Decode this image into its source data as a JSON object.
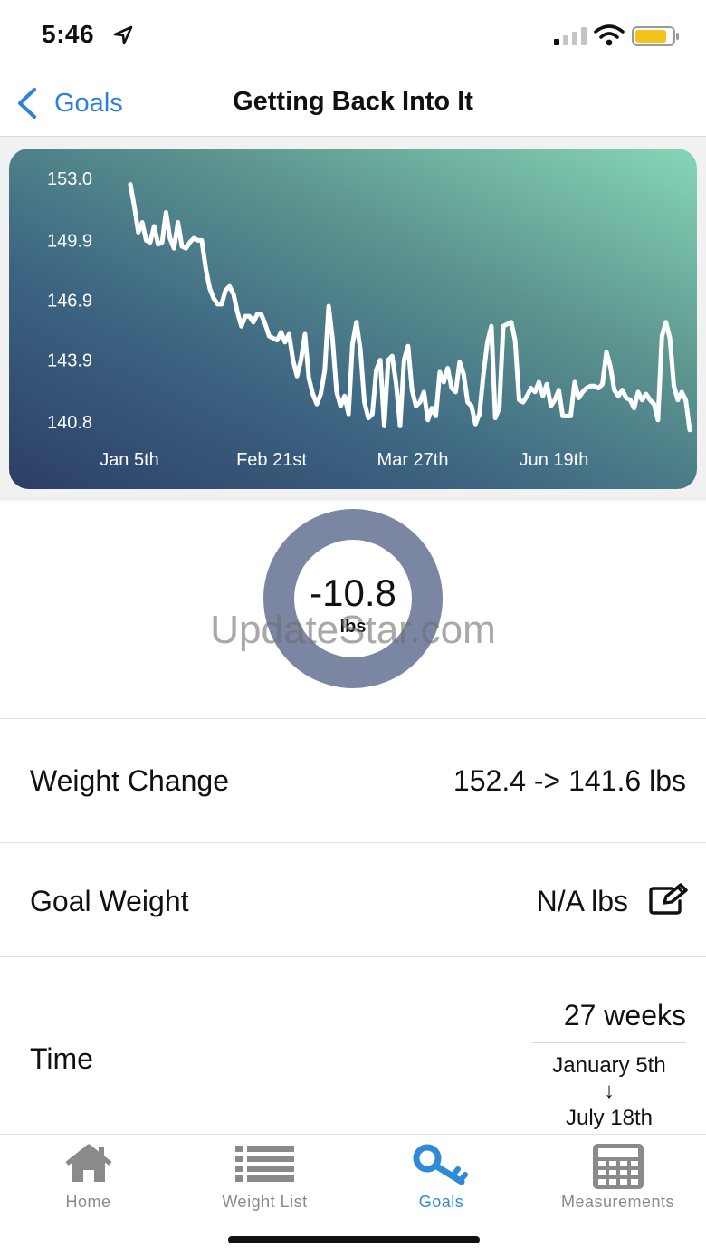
{
  "status_bar": {
    "time": "5:46",
    "icons": [
      "location-arrow-icon",
      "signal-icon",
      "wifi-icon",
      "battery-icon"
    ]
  },
  "nav": {
    "back_label": "Goals",
    "title": "Getting Back Into It"
  },
  "chart_data": {
    "type": "line",
    "y_ticks": [
      "153.0",
      "149.9",
      "146.9",
      "143.9",
      "140.8"
    ],
    "x_ticks": [
      "Jan 5th",
      "Feb 21st",
      "Mar 27th",
      "Jun 19th"
    ],
    "ylim": [
      140.8,
      153.0
    ],
    "values": [
      152.7,
      151.6,
      150.3,
      150.8,
      149.9,
      149.8,
      150.6,
      149.7,
      149.8,
      151.3,
      150.0,
      149.5,
      150.8,
      149.6,
      149.5,
      149.8,
      150.0,
      149.9,
      149.9,
      148.5,
      147.5,
      147.0,
      146.7,
      146.7,
      147.4,
      147.6,
      147.2,
      146.3,
      145.6,
      146.1,
      146.1,
      145.8,
      146.2,
      146.2,
      145.7,
      145.1,
      145.0,
      144.9,
      145.3,
      144.8,
      145.2,
      143.9,
      143.1,
      143.9,
      145.2,
      143.0,
      142.2,
      141.7,
      142.2,
      143.4,
      146.6,
      144.9,
      142.3,
      141.6,
      142.1,
      141.2,
      144.7,
      145.8,
      144.4,
      141.8,
      141.0,
      141.2,
      143.4,
      143.9,
      140.6,
      143.9,
      144.1,
      142.7,
      140.6,
      143.9,
      144.6,
      142.4,
      141.6,
      141.8,
      142.3,
      140.9,
      141.5,
      141.1,
      143.3,
      142.8,
      143.5,
      142.5,
      142.3,
      143.8,
      143.2,
      141.8,
      141.6,
      140.7,
      141.2,
      143.2,
      144.8,
      145.6,
      141.0,
      141.5,
      145.6,
      145.7,
      145.8,
      144.9,
      141.9,
      141.8,
      142.1,
      142.5,
      142.3,
      142.8,
      142.1,
      142.7,
      141.6,
      141.9,
      142.4,
      141.1,
      141.1,
      141.1,
      142.8,
      142.0,
      142.3,
      142.5,
      142.6,
      142.6,
      142.5,
      142.7,
      144.3,
      143.6,
      142.4,
      142.1,
      142.4,
      142.0,
      141.9,
      141.5,
      142.3,
      141.9,
      142.2,
      141.9,
      141.7,
      140.9,
      145.1,
      145.8,
      145.0,
      142.6,
      141.9,
      142.3,
      141.9,
      140.4
    ],
    "line_color": "#ffffff",
    "grid": false
  },
  "progress": {
    "value": "-10.8",
    "unit": "lbs",
    "fraction": 1.0,
    "ring_color": "#7b86a3"
  },
  "watermark": "UpdateStar.com",
  "weight_change": {
    "label": "Weight Change",
    "value": "152.4 -> 141.6 lbs"
  },
  "goal_weight": {
    "label": "Goal Weight",
    "value": "N/A lbs",
    "edit_icon": "edit-pencil-icon"
  },
  "time": {
    "label": "Time",
    "weeks": "27 weeks",
    "from": "January 5th",
    "arrow": "↓",
    "to": "July 18th"
  },
  "tabs": [
    {
      "label": "Home",
      "icon": "home-icon",
      "active": false
    },
    {
      "label": "Weight List",
      "icon": "list-icon",
      "active": false
    },
    {
      "label": "Goals",
      "icon": "key-icon",
      "active": true
    },
    {
      "label": "Measurements",
      "icon": "calculator-icon",
      "active": false
    }
  ],
  "colors": {
    "accent": "#2f80d8",
    "tab_active": "#2f8bd8",
    "tab_inactive": "#8a8a8a"
  }
}
